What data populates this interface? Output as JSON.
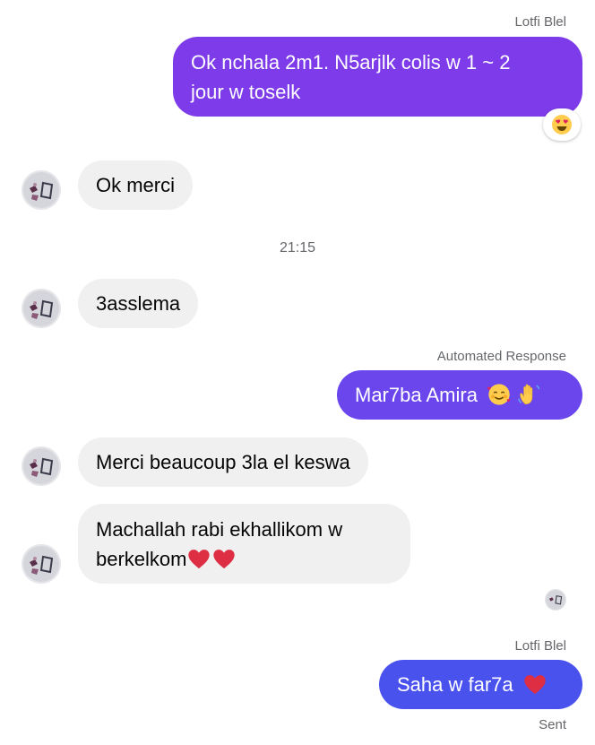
{
  "messages": {
    "m1_sender": "Lotfi Blel",
    "m1_line1": "Ok nchala 2m1. N5arjlk colis w 1 ~ 2",
    "m1_line2": "jour w toselk",
    "m1_reaction": "heart-eyes-emoji",
    "m2_text": "Ok merci",
    "timestamp": "21:15",
    "m3_text": "3asslema",
    "m4_sender": "Automated Response",
    "m4_text": "Mar7ba Amira",
    "m4_emojis": [
      "smiling-face-with-hearts-emoji",
      "waving-hand-emoji"
    ],
    "m5_text": "Merci beaucoup 3la el keswa",
    "m6_line1": "Machallah rabi ekhallikom w",
    "m6_line2": "berkelkom",
    "m6_emojis": [
      "red-heart-emoji",
      "red-heart-emoji"
    ],
    "m7_sender": "Lotfi Blel",
    "m7_text": "Saha w far7a",
    "m7_emoji": "red-heart-emoji",
    "status": "Sent"
  },
  "colors": {
    "outgoing_purple": "#7d3be9",
    "outgoing_blue": "#4a52ee",
    "incoming_bg": "#f0f0f0",
    "meta_text": "#65676b"
  }
}
